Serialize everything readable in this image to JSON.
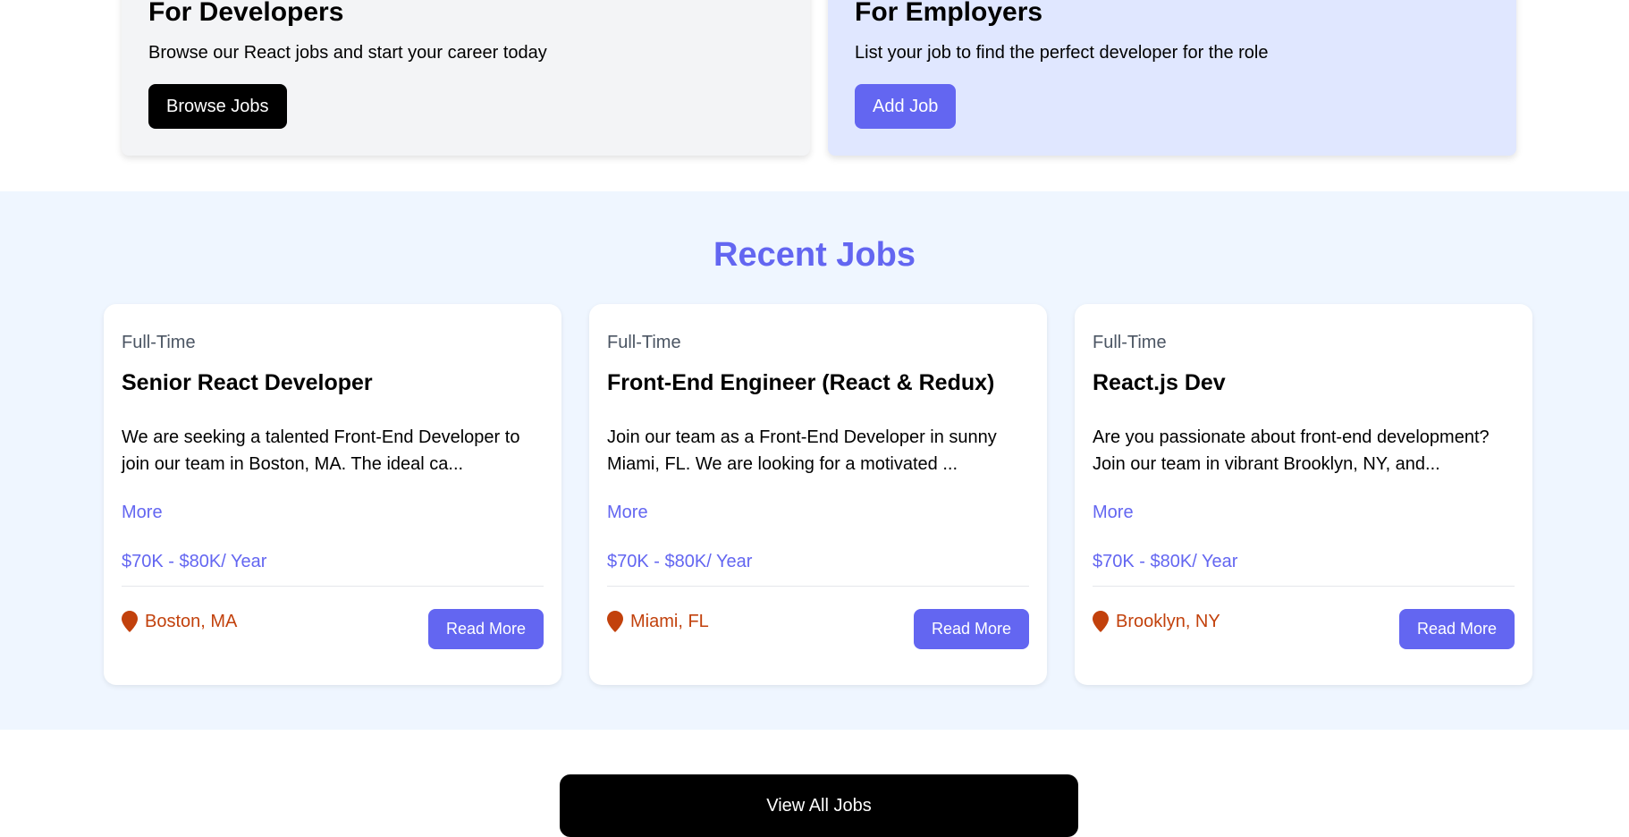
{
  "developers": {
    "title": "For Developers",
    "text": "Browse our React jobs and start your career today",
    "button": "Browse Jobs"
  },
  "employers": {
    "title": "For Employers",
    "text": "List your job to find the perfect developer for the role",
    "button": "Add Job"
  },
  "recent": {
    "title": "Recent Jobs",
    "jobs": [
      {
        "type": "Full-Time",
        "title": "Senior React Developer",
        "description": "We are seeking a talented Front-End Developer to join our team in Boston, MA. The ideal ca...",
        "more": "More",
        "salary": "$70K - $80K/ Year",
        "location": "Boston, MA",
        "button": "Read More"
      },
      {
        "type": "Full-Time",
        "title": "Front-End Engineer (React & Redux)",
        "description": "Join our team as a Front-End Developer in sunny Miami, FL. We are looking for a motivated ...",
        "more": "More",
        "salary": "$70K - $80K/ Year",
        "location": "Miami, FL",
        "button": "Read More"
      },
      {
        "type": "Full-Time",
        "title": "React.js Dev",
        "description": "Are you passionate about front-end development? Join our team in vibrant Brooklyn, NY, and...",
        "more": "More",
        "salary": "$70K - $80K/ Year",
        "location": "Brooklyn, NY",
        "button": "Read More"
      }
    ]
  },
  "view_all": "View All Jobs",
  "colors": {
    "accent": "#6366f1",
    "location": "#c2410c",
    "jobs_bg": "#eff6ff",
    "employer_card": "#e0e7ff",
    "developer_card": "#f3f4f6"
  },
  "icons": {
    "location": "map-marker-icon"
  }
}
